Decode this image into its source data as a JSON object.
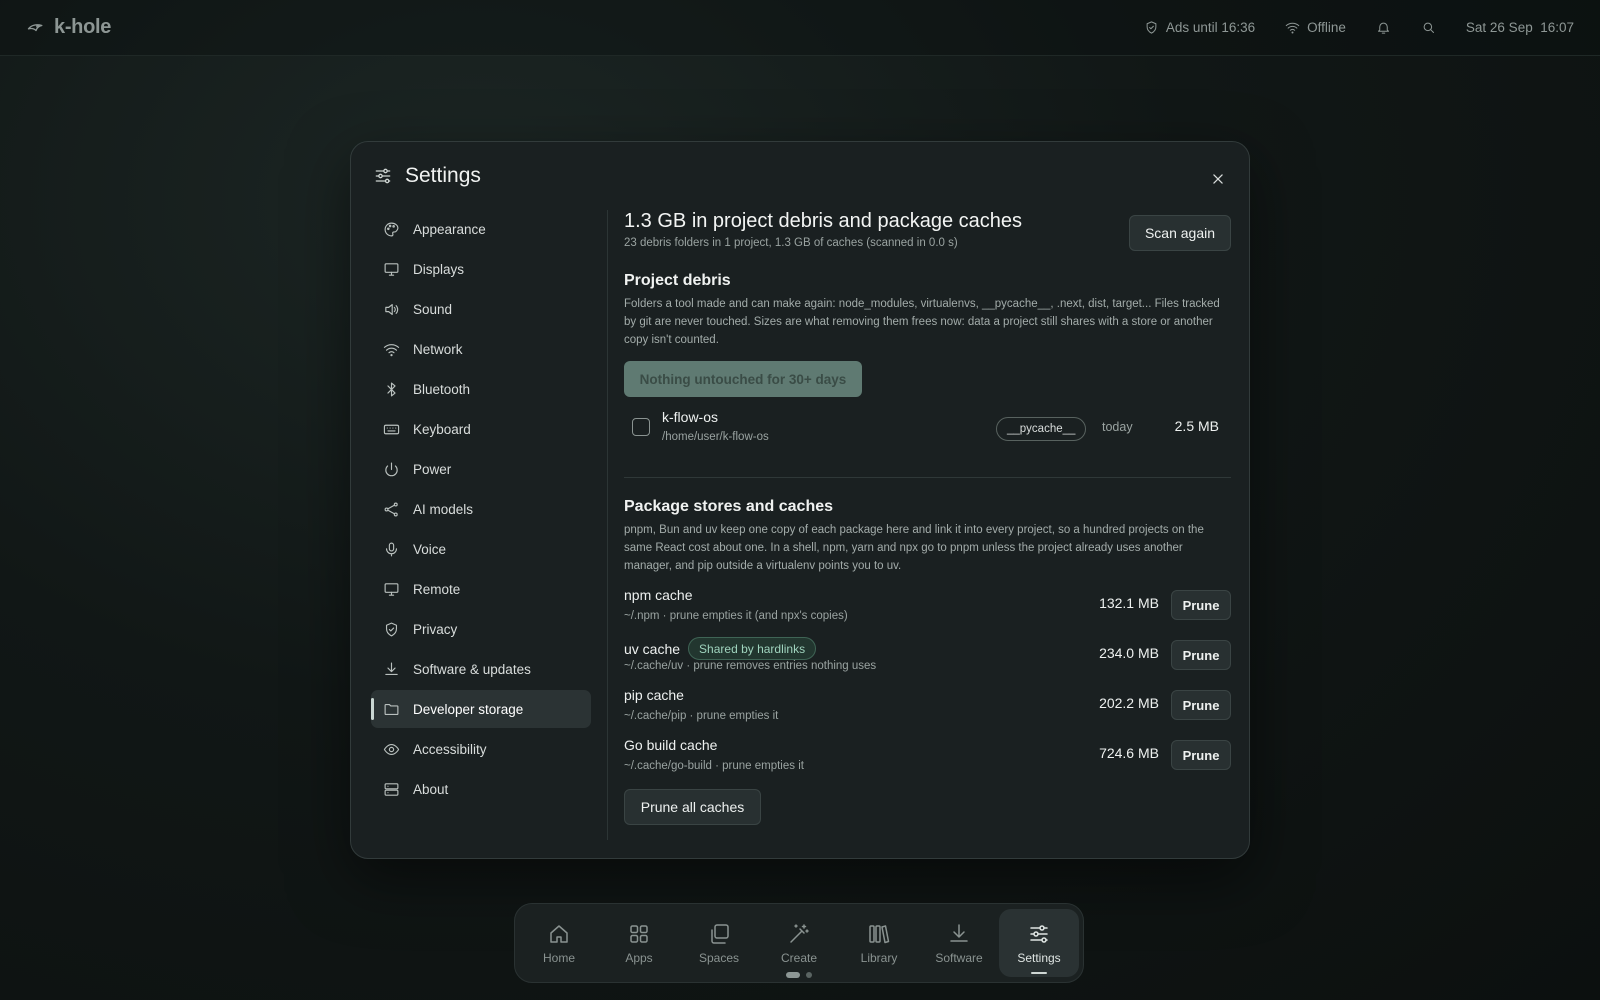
{
  "topbar": {
    "brand": "k-hole",
    "ads": "Ads until 16:36",
    "network": "Offline",
    "datetime": "Sat 26 Sep  16:07"
  },
  "modal": {
    "title": "Settings",
    "nav": [
      {
        "label": "Appearance",
        "icon": "palette-icon"
      },
      {
        "label": "Displays",
        "icon": "monitor-icon"
      },
      {
        "label": "Sound",
        "icon": "speaker-icon"
      },
      {
        "label": "Network",
        "icon": "wifi-icon"
      },
      {
        "label": "Bluetooth",
        "icon": "bluetooth-icon"
      },
      {
        "label": "Keyboard",
        "icon": "keyboard-icon"
      },
      {
        "label": "Power",
        "icon": "power-icon"
      },
      {
        "label": "AI models",
        "icon": "share-nodes-icon"
      },
      {
        "label": "Voice",
        "icon": "microphone-icon"
      },
      {
        "label": "Remote",
        "icon": "monitor-icon"
      },
      {
        "label": "Privacy",
        "icon": "shield-check-icon"
      },
      {
        "label": "Software & updates",
        "icon": "download-icon"
      },
      {
        "label": "Developer storage",
        "icon": "folder-icon",
        "active": true
      },
      {
        "label": "Accessibility",
        "icon": "eye-icon"
      },
      {
        "label": "About",
        "icon": "server-icon"
      }
    ]
  },
  "storage": {
    "headline": "1.3 GB in project debris and package caches",
    "summary": "23 debris folders in 1 project, 1.3 GB of caches (scanned in 0.0 s)",
    "scan_button": "Scan again",
    "debris": {
      "title": "Project debris",
      "description": "Folders a tool made and can make again: node_modules, virtualenvs, __pycache__, .next, dist, target... Files tracked by git are never touched. Sizes are what removing them frees now: data a project still shares with a store or another copy isn't counted.",
      "filter_button": "Nothing untouched for 30+ days",
      "projects": [
        {
          "name": "k-flow-os",
          "path": "/home/user/k-flow-os",
          "tag": "__pycache__",
          "when": "today",
          "size": "2.5 MB"
        }
      ]
    },
    "caches": {
      "title": "Package stores and caches",
      "description": "pnpm, Bun and uv keep one copy of each package here and link it into every project, so a hundred projects on the same React cost about one. In a shell, npm, yarn and npx go to pnpm unless the project already uses another manager, and pip outside a virtualenv points you to uv.",
      "items": [
        {
          "name": "npm cache",
          "badge": "",
          "meta": "~/.npm · prune empties it (and npx's copies)",
          "size": "132.1 MB",
          "action": "Prune"
        },
        {
          "name": "uv cache",
          "badge": "Shared by hardlinks",
          "meta": "~/.cache/uv · prune removes entries nothing uses",
          "size": "234.0 MB",
          "action": "Prune"
        },
        {
          "name": "pip cache",
          "badge": "",
          "meta": "~/.cache/pip · prune empties it",
          "size": "202.2 MB",
          "action": "Prune"
        },
        {
          "name": "Go build cache",
          "badge": "",
          "meta": "~/.cache/go-build · prune empties it",
          "size": "724.6 MB",
          "action": "Prune"
        }
      ],
      "prune_all": "Prune all caches"
    }
  },
  "dock": [
    {
      "label": "Home",
      "icon": "home-icon"
    },
    {
      "label": "Apps",
      "icon": "grid-icon"
    },
    {
      "label": "Spaces",
      "icon": "copy-icon"
    },
    {
      "label": "Create",
      "icon": "magic-wand-icon"
    },
    {
      "label": "Library",
      "icon": "library-icon"
    },
    {
      "label": "Software",
      "icon": "download-icon"
    },
    {
      "label": "Settings",
      "icon": "sliders-icon",
      "active": true
    }
  ],
  "colors": {
    "background": "#111716",
    "panel": "#1a2021",
    "accent_badge": "#9fd3bd",
    "active_nav": "#2b3334"
  }
}
